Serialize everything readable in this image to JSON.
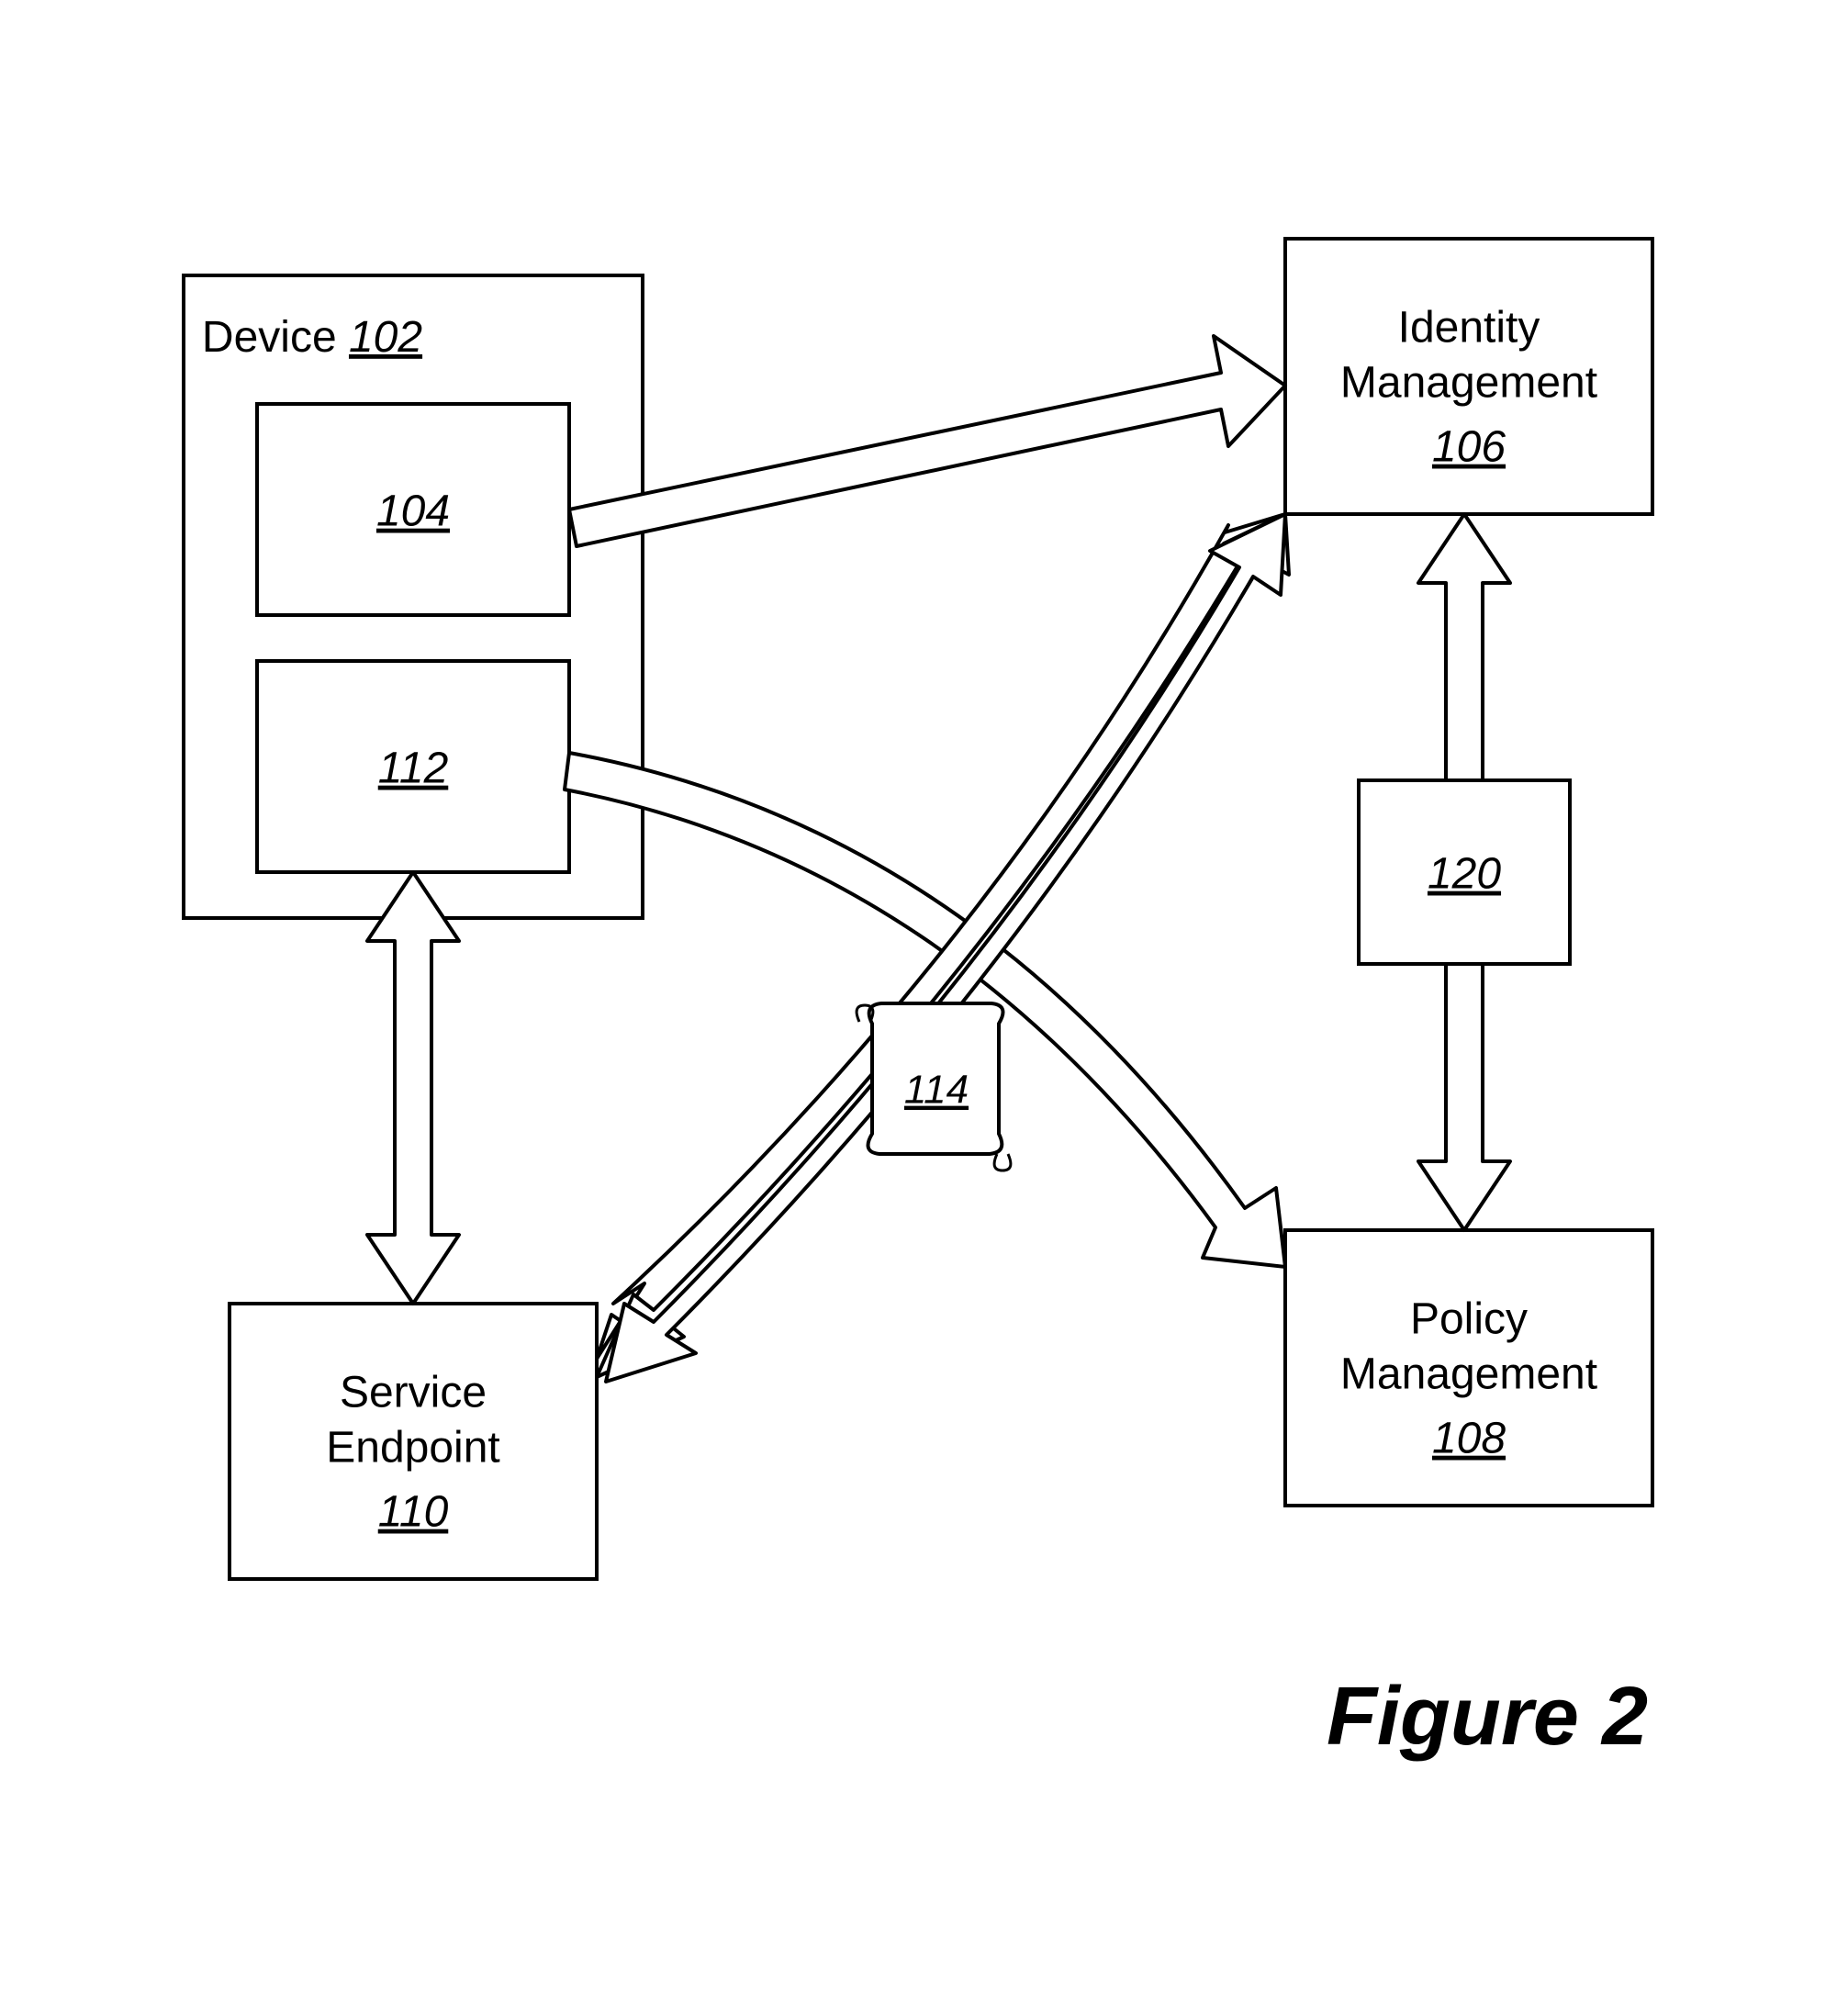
{
  "nodes": {
    "device": {
      "label": "Device",
      "ref": "102"
    },
    "inner_top": {
      "ref": "104"
    },
    "inner_bottom": {
      "ref": "112"
    },
    "identity_mgmt": {
      "line1": "Identity",
      "line2": "Management",
      "ref": "106"
    },
    "policy_mgmt": {
      "line1": "Policy",
      "line2": "Management",
      "ref": "108"
    },
    "service_endpoint": {
      "line1": "Service",
      "line2": "Endpoint",
      "ref": "110"
    },
    "middle_right": {
      "ref": "120"
    },
    "scroll": {
      "ref": "114"
    }
  },
  "caption": "Figure 2"
}
